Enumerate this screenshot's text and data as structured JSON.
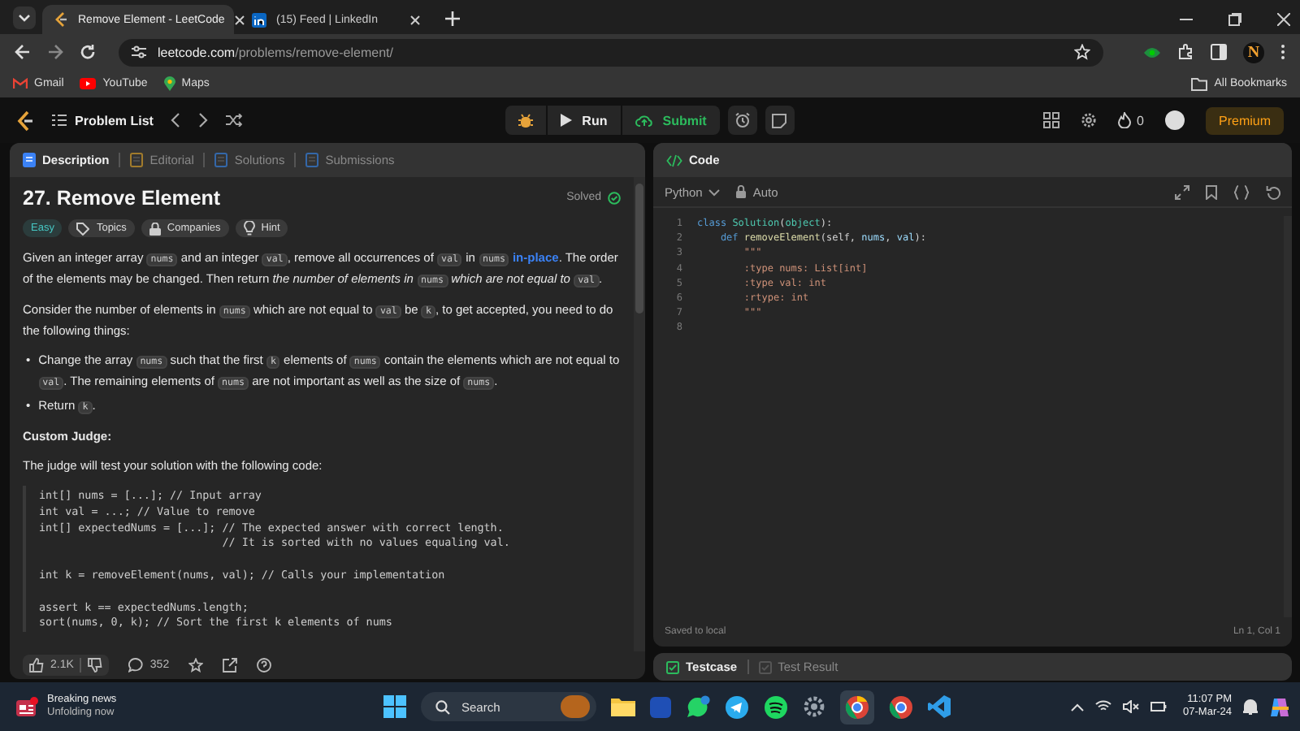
{
  "browser": {
    "tabs": [
      {
        "title": "Remove Element - LeetCode",
        "selected": true
      },
      {
        "title": "(15) Feed | LinkedIn",
        "selected": false
      }
    ],
    "address": {
      "host": "leetcode.com",
      "path": "/problems/remove-element/"
    },
    "profile_initial": "N",
    "bookmarks": [
      "Gmail",
      "YouTube",
      "Maps"
    ],
    "all_bookmarks": "All Bookmarks"
  },
  "nav": {
    "problem_list": "Problem List",
    "run": "Run",
    "submit": "Submit",
    "streak": "0",
    "premium": "Premium"
  },
  "description_tabs": [
    {
      "label": "Description",
      "selected": true
    },
    {
      "label": "Editorial",
      "selected": false
    },
    {
      "label": "Solutions",
      "selected": false
    },
    {
      "label": "Submissions",
      "selected": false
    }
  ],
  "problem": {
    "title": "27. Remove Element",
    "status": "Solved",
    "difficulty": "Easy",
    "tags": [
      "Topics",
      "Companies",
      "Hint"
    ],
    "blocks": [
      {
        "kind": "paragraph",
        "segments": [
          {
            "kind": "text",
            "text": "Given an integer array "
          },
          {
            "kind": "code",
            "text": "nums"
          },
          {
            "kind": "text",
            "text": " and an integer "
          },
          {
            "kind": "code",
            "text": "val"
          },
          {
            "kind": "text",
            "text": ", remove all occurrences of "
          },
          {
            "kind": "code",
            "text": "val"
          },
          {
            "kind": "text",
            "text": " in "
          },
          {
            "kind": "code",
            "text": "nums"
          },
          {
            "kind": "link",
            "text": "in-place"
          },
          {
            "kind": "text",
            "text": ". The order of the elements may be changed. Then return "
          },
          {
            "kind": "em",
            "text": "the number of elements in "
          },
          {
            "kind": "code",
            "text": "nums"
          },
          {
            "kind": "em",
            "text": " which are not equal to "
          },
          {
            "kind": "code",
            "text": "val"
          },
          {
            "kind": "text",
            "text": "."
          }
        ]
      },
      {
        "kind": "paragraph",
        "segments": [
          {
            "kind": "text",
            "text": "Consider the number of elements in "
          },
          {
            "kind": "code",
            "text": "nums"
          },
          {
            "kind": "text",
            "text": " which are not equal to "
          },
          {
            "kind": "code",
            "text": "val"
          },
          {
            "kind": "text",
            "text": " be "
          },
          {
            "kind": "code",
            "text": "k"
          },
          {
            "kind": "text",
            "text": ", to get accepted, you need to do the following things:"
          }
        ]
      },
      {
        "kind": "bullets",
        "marker": "•",
        "items": [
          [
            {
              "kind": "text",
              "text": "Change the array "
            },
            {
              "kind": "code",
              "text": "nums"
            },
            {
              "kind": "text",
              "text": " such that the first "
            },
            {
              "kind": "code",
              "text": "k"
            },
            {
              "kind": "text",
              "text": " elements of "
            },
            {
              "kind": "code",
              "text": "nums"
            },
            {
              "kind": "text",
              "text": " contain the elements which are not equal to "
            },
            {
              "kind": "code",
              "text": "val"
            },
            {
              "kind": "text",
              "text": ". The remaining elements of "
            },
            {
              "kind": "code",
              "text": "nums"
            },
            {
              "kind": "text",
              "text": " are not important as well as the size of "
            },
            {
              "kind": "code",
              "text": "nums"
            },
            {
              "kind": "text",
              "text": "."
            }
          ],
          [
            {
              "kind": "text",
              "text": "Return "
            },
            {
              "kind": "code",
              "text": "k"
            },
            {
              "kind": "text",
              "text": "."
            }
          ]
        ]
      },
      {
        "kind": "heading",
        "text": "Custom Judge:"
      },
      {
        "kind": "paragraph",
        "segments": [
          {
            "kind": "text",
            "text": "The judge will test your solution with the following code:"
          }
        ]
      },
      {
        "kind": "codeblock",
        "text": "int[] nums = [...]; // Input array\nint val = ...; // Value to remove\nint[] expectedNums = [...]; // The expected answer with correct length.\n                            // It is sorted with no values equaling val.\n\nint k = removeElement(nums, val); // Calls your implementation\n\nassert k == expectedNums.length;\nsort(nums, 0, k); // Sort the first k elements of nums"
      }
    ],
    "likes": "2.1K",
    "comments": "352"
  },
  "editor": {
    "title": "Code",
    "language": "Python",
    "mode": "Auto",
    "lines": [
      {
        "number": "1",
        "tokens": [
          {
            "kind": "kw",
            "text": "class "
          },
          {
            "kind": "cls",
            "text": "Solution"
          },
          {
            "kind": "punct",
            "text": "("
          },
          {
            "kind": "cls",
            "text": "object"
          },
          {
            "kind": "punct",
            "text": "):"
          }
        ]
      },
      {
        "number": "2",
        "tokens": [
          {
            "kind": "kw",
            "text": "    def "
          },
          {
            "kind": "fn",
            "text": "removeElement"
          },
          {
            "kind": "punct",
            "text": "(self, "
          },
          {
            "kind": "var",
            "text": "nums"
          },
          {
            "kind": "punct",
            "text": ", "
          },
          {
            "kind": "var",
            "text": "val"
          },
          {
            "kind": "punct",
            "text": "):"
          }
        ]
      },
      {
        "number": "3",
        "tokens": [
          {
            "kind": "str",
            "text": "        \"\"\""
          }
        ]
      },
      {
        "number": "4",
        "tokens": [
          {
            "kind": "str",
            "text": "        :type nums: List[int]"
          }
        ]
      },
      {
        "number": "5",
        "tokens": [
          {
            "kind": "str",
            "text": "        :type val: int"
          }
        ]
      },
      {
        "number": "6",
        "tokens": [
          {
            "kind": "str",
            "text": "        :rtype: int"
          }
        ]
      },
      {
        "number": "7",
        "tokens": [
          {
            "kind": "str",
            "text": "        \"\"\""
          }
        ]
      },
      {
        "number": "8"
      }
    ],
    "saved": "Saved to local",
    "cursor": "Ln 1, Col 1"
  },
  "console_tabs": [
    {
      "label": "Testcase",
      "selected": true
    },
    {
      "label": "Test Result",
      "selected": false
    }
  ],
  "taskbar": {
    "news_title": "Breaking news",
    "news_subtitle": "Unfolding now",
    "search": "Search",
    "time": "11:07 PM",
    "date": "07-Mar-24"
  }
}
